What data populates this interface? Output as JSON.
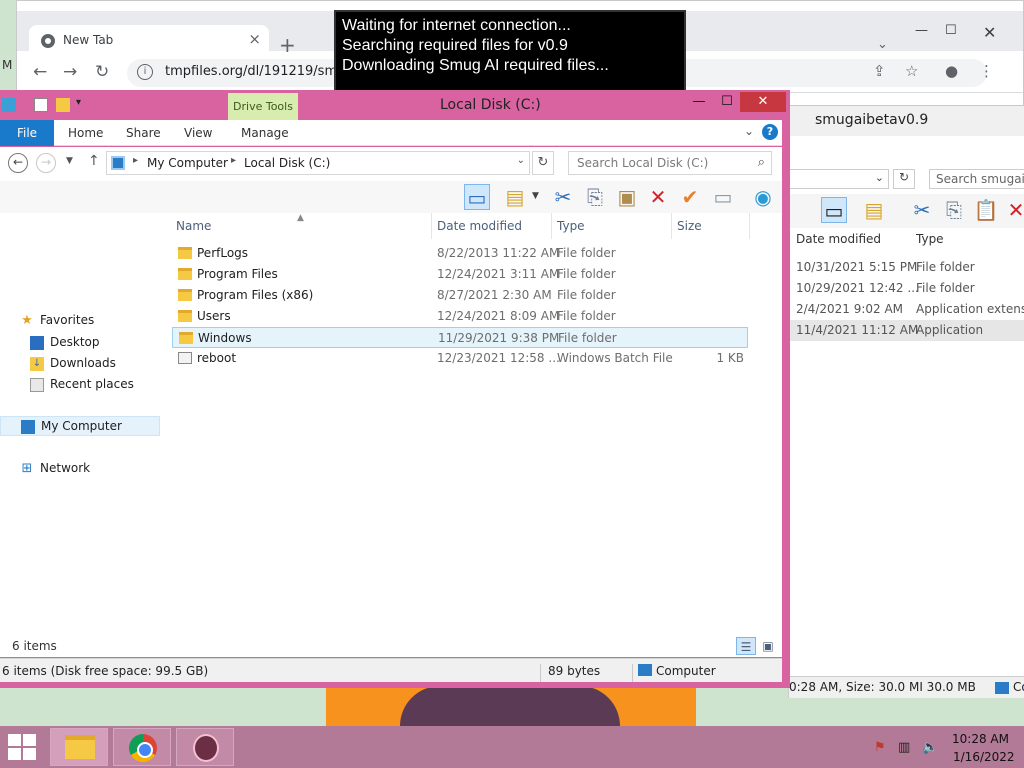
{
  "browser": {
    "tab_title": "New Tab",
    "url": "tmpfiles.org/dl/191219/sm",
    "left_cut_text": "M"
  },
  "loader": {
    "lines": [
      "Waiting for internet connection...",
      "Searching required files for v0.9",
      "Downloading Smug AI required files..."
    ]
  },
  "explorer2": {
    "title": "smugaibetav0.9",
    "search_placeholder": "Search smugaibe",
    "columns": [
      "Date modified",
      "Type"
    ],
    "rows": [
      {
        "date": "10/31/2021 5:15 PM",
        "type": "File folder"
      },
      {
        "date": "10/29/2021 12:42 ...",
        "type": "File folder"
      },
      {
        "date": "2/4/2021 9:02 AM",
        "type": "Application extens..."
      },
      {
        "date": "11/4/2021 11:12 AM",
        "type": "Application"
      }
    ],
    "status_text": "0:28 AM, Size: 30.0 MI 30.0 MB",
    "status_right": "Co"
  },
  "explorer": {
    "title": "Local Disk (C:)",
    "contextual_tab": "Drive Tools",
    "ribbon_tabs": [
      "File",
      "Home",
      "Share",
      "View",
      "Manage"
    ],
    "breadcrumb": [
      "My Computer",
      "Local Disk (C:)"
    ],
    "search_placeholder": "Search Local Disk (C:)",
    "nav": {
      "favorites": "Favorites",
      "desktop": "Desktop",
      "downloads": "Downloads",
      "recent": "Recent places",
      "computer": "My Computer",
      "network": "Network"
    },
    "columns": {
      "name": "Name",
      "date": "Date modified",
      "type": "Type",
      "size": "Size"
    },
    "files": [
      {
        "name": "PerfLogs",
        "date": "8/22/2013 11:22 AM",
        "type": "File folder",
        "size": "",
        "icon": "folder-icon"
      },
      {
        "name": "Program Files",
        "date": "12/24/2021 3:11 AM",
        "type": "File folder",
        "size": "",
        "icon": "folder-icon"
      },
      {
        "name": "Program Files (x86)",
        "date": "8/27/2021 2:30 AM",
        "type": "File folder",
        "size": "",
        "icon": "folder-icon"
      },
      {
        "name": "Users",
        "date": "12/24/2021 8:09 AM",
        "type": "File folder",
        "size": "",
        "icon": "folder-icon"
      },
      {
        "name": "Windows",
        "date": "11/29/2021 9:38 PM",
        "type": "File folder",
        "size": "",
        "icon": "folder-icon",
        "selected": true
      },
      {
        "name": "reboot",
        "date": "12/23/2021 12:58 ...",
        "type": "Windows Batch File",
        "size": "1 KB",
        "icon": "batch-file-icon"
      }
    ],
    "item_count": "6 items",
    "status": {
      "items_free": "6 items (Disk free space: 99.5 GB)",
      "bytes": "89 bytes",
      "location": "Computer"
    }
  },
  "taskbar": {
    "time": "10:28 AM",
    "date": "1/16/2022"
  },
  "colors": {
    "window_frame": "#d863a0",
    "file_tab": "#1979ca",
    "close_button": "#c7373f",
    "drive_tools_tab": "#d8ecb0",
    "taskbar": "#b27a96",
    "orange_background": "#f7921e"
  }
}
